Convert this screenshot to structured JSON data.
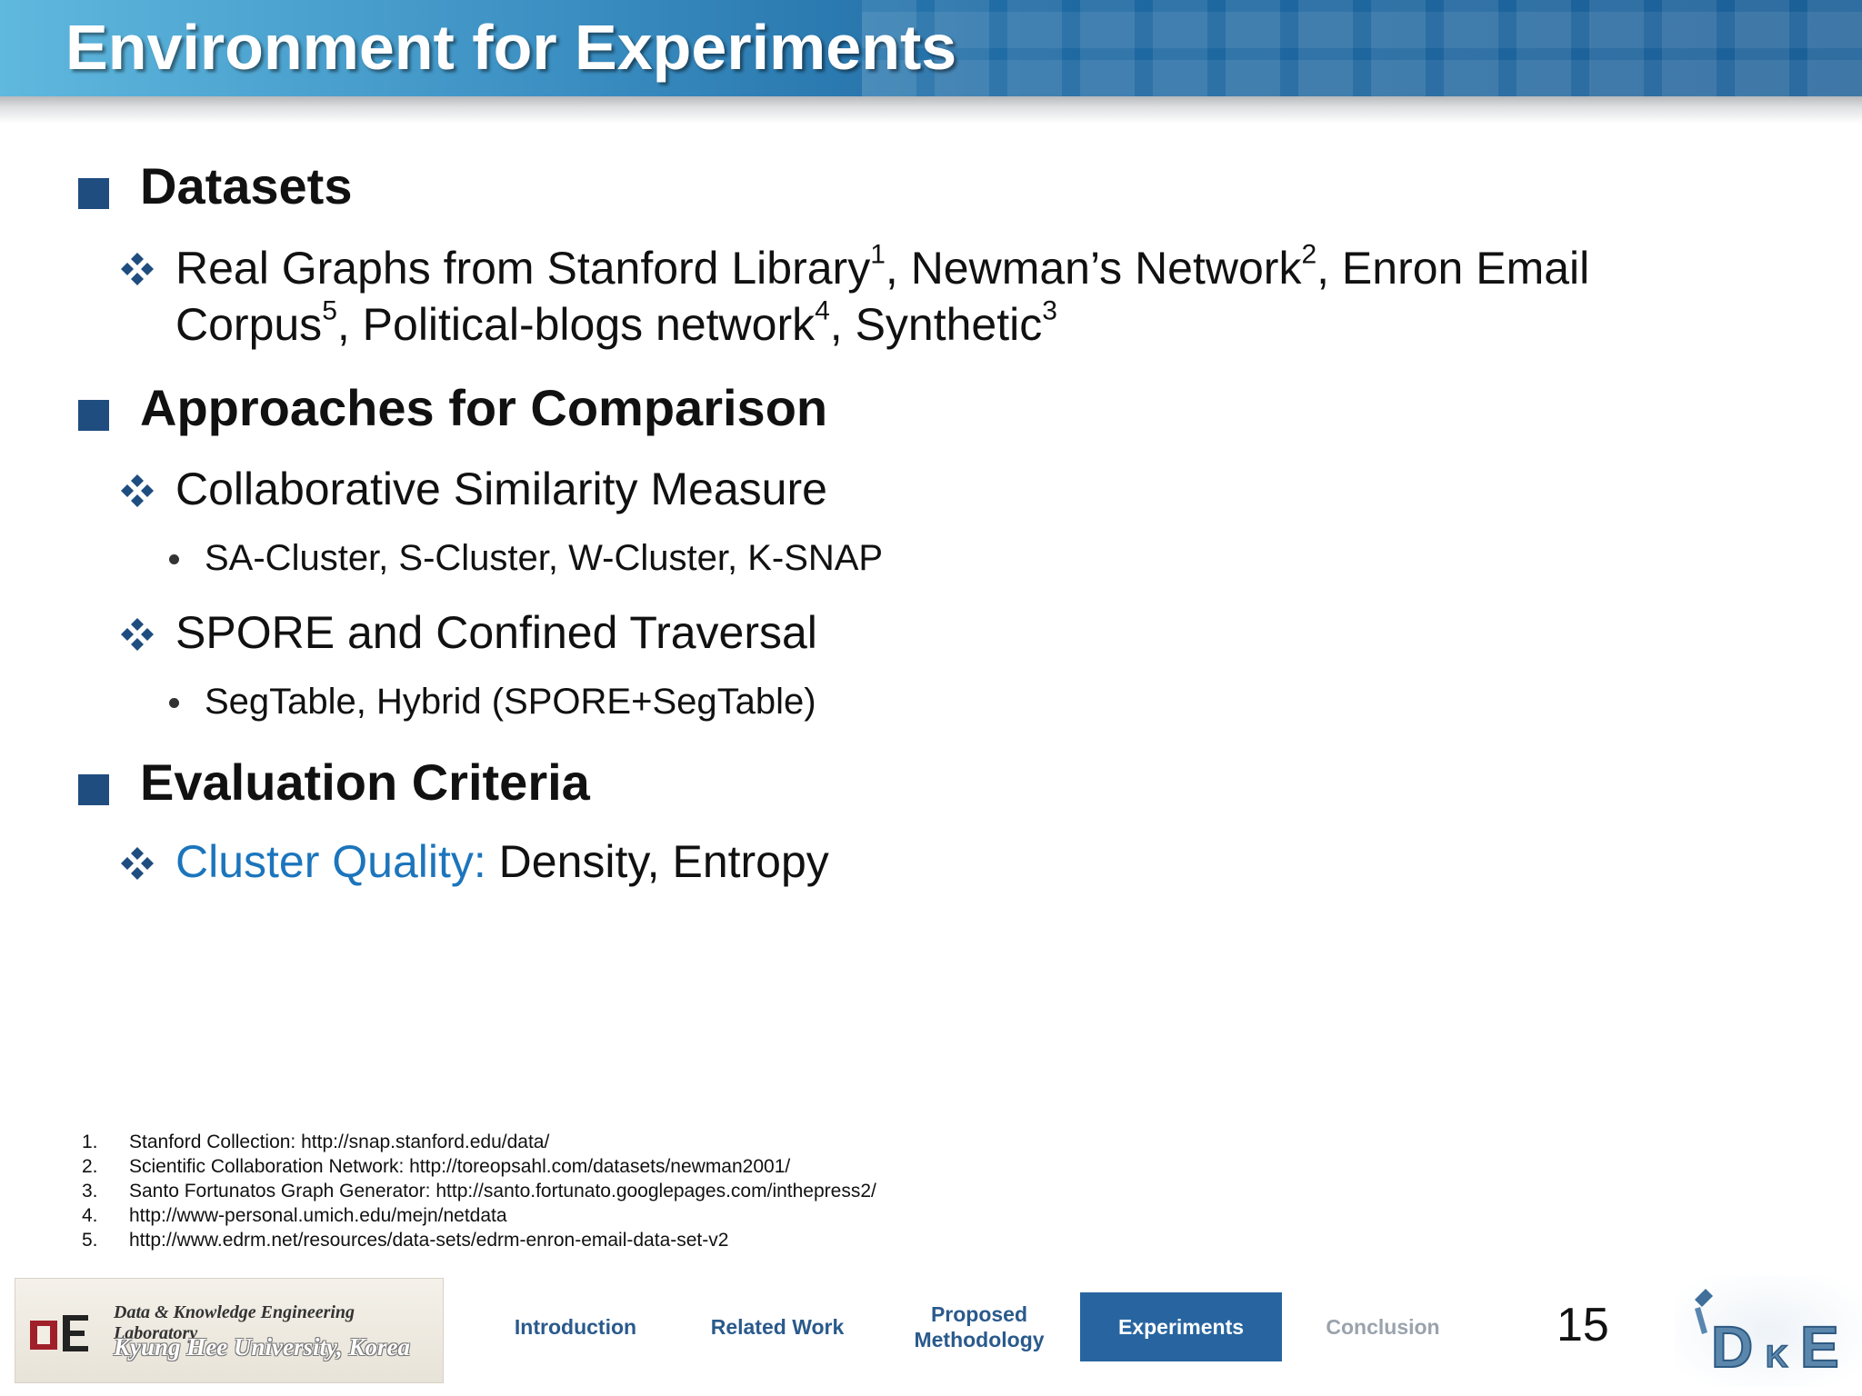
{
  "title": "Environment for Experiments",
  "sections": [
    {
      "heading": "Datasets",
      "items": [
        {
          "line1": {
            "a": "Real Graphs from Stanford Library",
            "a_sup": "1",
            "b": ", Newman’s Network",
            "b_sup": "2",
            "c": ", Enron Email"
          },
          "line2": {
            "a": "Corpus",
            "a_sup": "5",
            "b": ", Political-blogs network",
            "b_sup": "4",
            "c": ", Synthetic",
            "c_sup": "3"
          }
        }
      ]
    },
    {
      "heading": "Approaches for Comparison",
      "items": [
        {
          "text": "Collaborative Similarity Measure",
          "sub": "SA-Cluster, S-Cluster, W-Cluster, K-SNAP"
        },
        {
          "text": "SPORE and Confined Traversal",
          "sub": "SegTable, Hybrid (SPORE+SegTable)"
        }
      ]
    },
    {
      "heading": "Evaluation Criteria",
      "items": [
        {
          "highlight": "Cluster Quality:",
          "text": " Density, Entropy"
        }
      ]
    }
  ],
  "footnotes": [
    {
      "num": "1.",
      "text": "Stanford Collection: http://snap.stanford.edu/data/"
    },
    {
      "num": "2.",
      "text": "Scientific Collaboration Network: http://toreopsahl.com/datasets/newman2001/"
    },
    {
      "num": "3.",
      "text": "Santo Fortunatos Graph Generator: http://santo.fortunato.googlepages.com/inthepress2/"
    },
    {
      "num": "4.",
      "text": "http://www-personal.umich.edu/mejn/netdata"
    },
    {
      "num": "5.",
      "text": "http://www.edrm.net/resources/data-sets/edrm-enron-email-data-set-v2"
    }
  ],
  "footer": {
    "lab_line1": "Data & Knowledge Engineering Laboratory",
    "lab_line2": "Kyung Hee University, Korea",
    "nav": [
      {
        "label": "Introduction"
      },
      {
        "label": "Related Work"
      },
      {
        "label": "Proposed Methodology"
      },
      {
        "label": "Experiments"
      },
      {
        "label": "Conclusion"
      }
    ],
    "active_nav": "Experiments",
    "page_number": "15"
  },
  "colors": {
    "banner": "#1f6aa3",
    "bullet_square": "#1f4d80",
    "accent_text": "#1c75bc",
    "active_nav_bg": "#2865a0"
  }
}
